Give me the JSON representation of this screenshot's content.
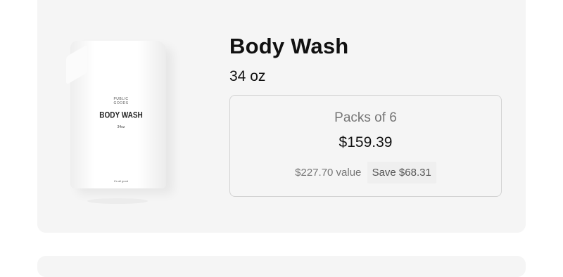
{
  "product": {
    "title": "Body Wash",
    "size": "34 oz",
    "image": {
      "brand_line1": "PUBLIC",
      "brand_line2": "GOODS",
      "name": "BODY WASH",
      "size": "34oz",
      "tagline": "It's all good"
    }
  },
  "pack_option": {
    "label": "Packs of 6",
    "price": "$159.39",
    "value": "$227.70 value",
    "savings": "Save $68.31"
  },
  "colors": {
    "card_background": "#f5f5f5",
    "text_primary": "#111111",
    "text_muted": "#767676",
    "border": "#d3d3d3",
    "badge_background": "#efefef"
  }
}
